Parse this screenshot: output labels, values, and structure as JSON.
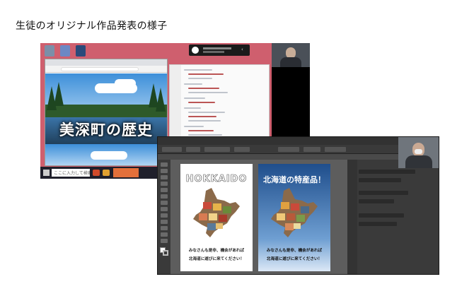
{
  "page": {
    "title": "生徒のオリジナル作品発表の様子"
  },
  "screenshot_browser": {
    "heading": "美深町の歴史",
    "taskbar_search": "ここに入力して検索"
  },
  "screenshot_illustrator": {
    "artboard_left": {
      "title": "HOKKAIDO",
      "message_line1": "みなさんも是非、機会があれば",
      "message_line2": "北海道に遊びに来てください！"
    },
    "artboard_right": {
      "title": "北海道の特産品！",
      "message_line1": "みなさんも是非、機会があれば",
      "message_line2": "北海道に遊びに来てください！"
    }
  },
  "colors": {
    "desktop": "#cf5f6e",
    "artboard_right_top": "#1f4e8c"
  }
}
